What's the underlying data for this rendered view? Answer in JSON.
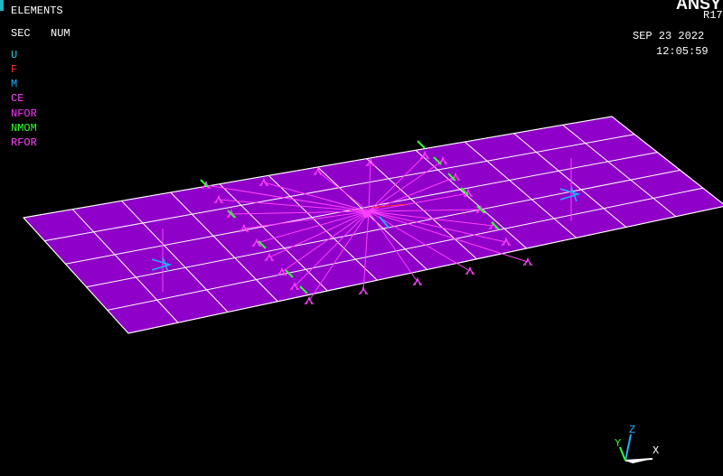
{
  "viewport_title": "ELEMENTS",
  "labels": {
    "sec": "SEC",
    "num": "NUM"
  },
  "legend": [
    {
      "text": "U",
      "color": "#1fd0d0"
    },
    {
      "text": "F",
      "color": "#ff3030"
    },
    {
      "text": "M",
      "color": "#1fb0ff"
    },
    {
      "text": "CE",
      "color": "#ff40ff"
    },
    {
      "text": "NFOR",
      "color": "#ff30ff"
    },
    {
      "text": "NMOM",
      "color": "#30ff30"
    },
    {
      "text": "RFOR",
      "color": "#ff40ff"
    }
  ],
  "header_right": {
    "product": "ANSY",
    "release": "R17",
    "date": "SEP 23 2022",
    "time": "12:05:59"
  },
  "triad": {
    "x_label": "X",
    "y_label": "Y",
    "z_label": "Z"
  },
  "colors": {
    "background": "#000000",
    "plate_fill": "#8f00c8",
    "grid_line": "#ffffff",
    "constraint": "#ff40ff",
    "moment": "#30ff30",
    "force_blue": "#1fb0ff",
    "text": "#ffffff"
  }
}
